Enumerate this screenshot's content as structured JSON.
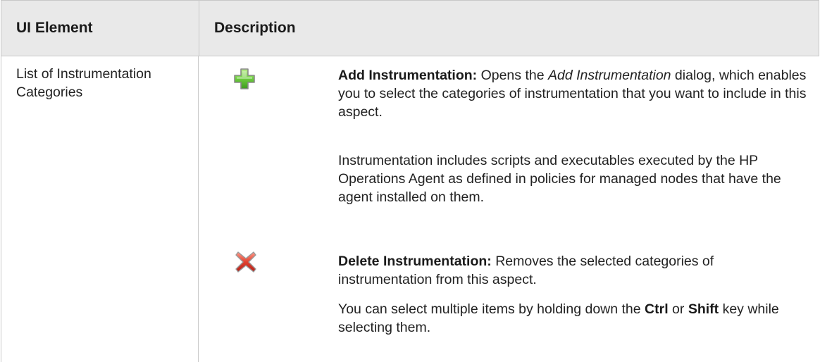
{
  "table": {
    "headers": {
      "col1": "UI Element",
      "col2": "Description"
    },
    "row": {
      "ui_element": "List of Instrumentation Categories",
      "add": {
        "icon": "green-plus-icon",
        "title": "Add Instrumentation:",
        "text_before": " Opens the ",
        "dialog_name": "Add Instrumentation",
        "text_after": " dialog, which enables you to select the categories of instrumentation that you want to include in this aspect."
      },
      "add_note": "Instrumentation includes scripts and executables executed by the HP Operations Agent as defined in policies for managed nodes that have the agent installed on them.",
      "delete": {
        "icon": "red-x-icon",
        "title": "Delete Instrumentation:",
        "text": " Removes the selected categories of instrumentation from this aspect."
      },
      "delete_note": {
        "part1": "You can select multiple items by holding down the ",
        "key1": "Ctrl",
        "part2": " or ",
        "key2": "Shift",
        "part3": " key while selecting them."
      }
    }
  },
  "colors": {
    "header_bg": "#e9e9e9",
    "border": "#c8c8c8",
    "add_green": "#5fbf3a",
    "delete_red": "#d9342b"
  }
}
